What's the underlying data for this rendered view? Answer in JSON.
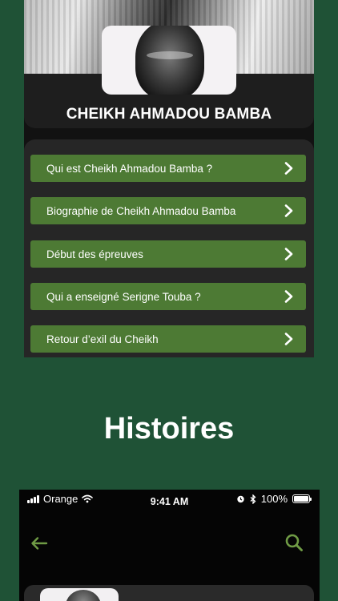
{
  "hero": {
    "title": "CHEIKH AHMADOU BAMBA",
    "image_icon": "portrait-photo"
  },
  "menu": {
    "items": [
      {
        "label": "Qui est Cheikh Ahmadou Bamba ?",
        "icon": "chevron-right-icon"
      },
      {
        "label": "Biographie de Cheikh Ahmadou Bamba",
        "icon": "chevron-right-icon"
      },
      {
        "label": "Début des épreuves",
        "icon": "chevron-right-icon"
      },
      {
        "label": "Qui a enseigné Serigne Touba ?",
        "icon": "chevron-right-icon"
      },
      {
        "label": "Retour d’exil du Cheikh",
        "icon": "chevron-right-icon"
      }
    ]
  },
  "section": {
    "heading": "Histoires"
  },
  "status_bar": {
    "carrier": "Orange",
    "time": "9:41 AM",
    "battery": "100%",
    "battery_level": 1.0
  },
  "navbar": {
    "back_icon": "arrow-left-icon",
    "search_icon": "search-icon"
  },
  "colors": {
    "background": "#1f5236",
    "button": "#4d7a34",
    "accent": "#6f9b45",
    "panel": "#262626"
  }
}
